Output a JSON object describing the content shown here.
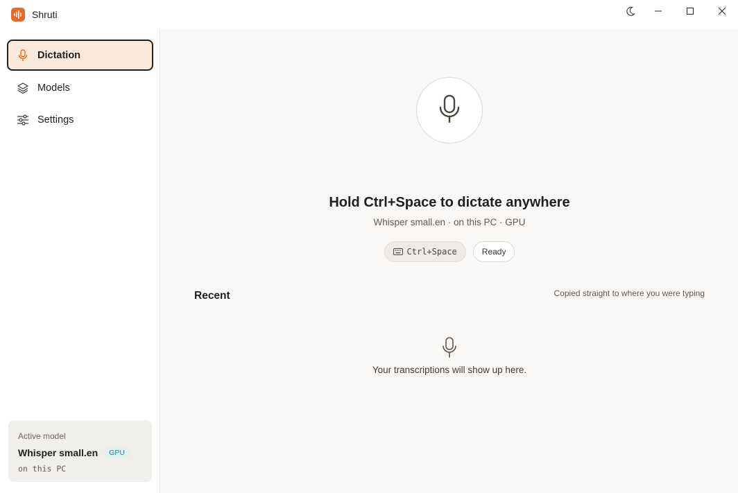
{
  "app": {
    "title": "Shruti",
    "logo_icon": "soundwave-icon",
    "accent_color": "#e8692c"
  },
  "titlebar": {
    "theme_toggle_icon": "moon-icon",
    "minimize_icon": "minimize-icon",
    "maximize_icon": "maximize-icon",
    "close_icon": "close-icon"
  },
  "sidebar": {
    "items": [
      {
        "label": "Dictation",
        "icon": "microphone-icon",
        "active": true
      },
      {
        "label": "Models",
        "icon": "layers-icon",
        "active": false
      },
      {
        "label": "Settings",
        "icon": "sliders-icon",
        "active": false
      }
    ],
    "model_card": {
      "caption": "Active model",
      "name": "Whisper small.en",
      "badge": "GPU",
      "location": "on this PC"
    }
  },
  "main": {
    "record_button_icon": "microphone-icon",
    "headline": "Hold Ctrl+Space to dictate anywhere",
    "subline": "Whisper small.en · on this PC · GPU",
    "hotkey_chip": "Ctrl+Space",
    "hotkey_icon": "keyboard-icon",
    "status_chip": "Ready",
    "recent": {
      "title": "Recent",
      "note": "Copied straight to where you were typing",
      "empty_icon": "microphone-icon",
      "empty_text": "Your transcriptions will show up here."
    }
  }
}
